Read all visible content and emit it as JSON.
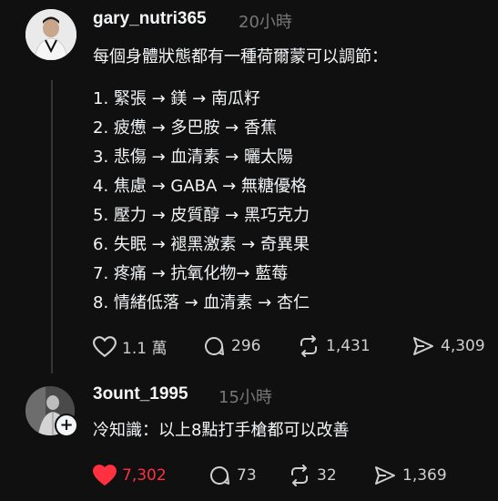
{
  "post1": {
    "username": "gary_nutri365",
    "time": "20小時",
    "text": "每個身體狀態都有一種荷爾蒙可以調節：",
    "list": [
      "1. 緊張 → 鎂 → 南瓜籽",
      "2. 疲憊 → 多巴胺 → 香蕉",
      "3. 悲傷 → 血清素 → 曬太陽",
      "4. 焦慮 → GABA → 無糖優格",
      "5. 壓力 → 皮質醇 → 黑巧克力",
      "6. 失眠 → 褪黑激素 → 奇異果",
      "7. 疼痛 → 抗氧化物→ 藍莓",
      "8. 情緒低落 → 血清素 → 杏仁"
    ],
    "likes": "1.1 萬",
    "comments": "296",
    "reposts": "1,431",
    "shares": "4,309"
  },
  "post2": {
    "username": "3ount_1995",
    "time": "15小時",
    "text": "冷知識：以上8點打手槍都可以改善",
    "likes": "7,302",
    "comments": "73",
    "reposts": "32",
    "shares": "1,369"
  },
  "colors": {
    "background": "#101010",
    "text": "#f3f5f7",
    "muted": "#777777",
    "like_active": "#ff3040"
  }
}
